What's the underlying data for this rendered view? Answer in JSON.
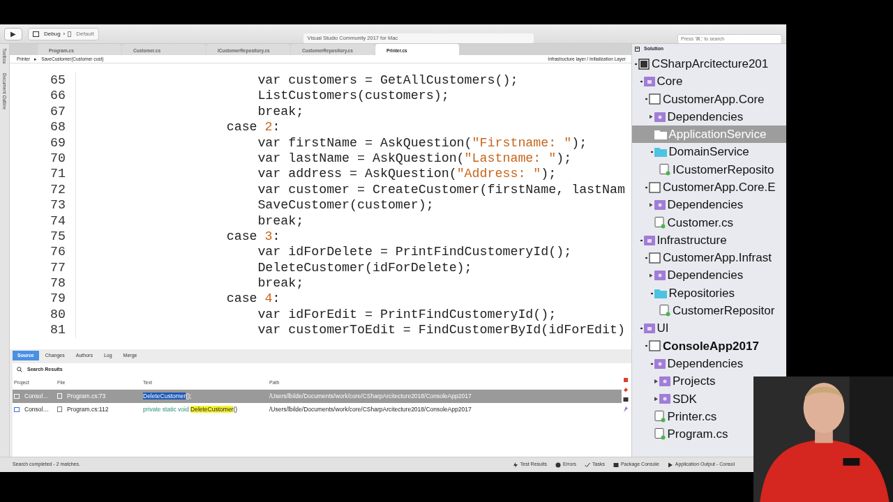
{
  "toolbar": {
    "run_label": "▶",
    "config": "Debug",
    "separator": "›",
    "target": "Default",
    "title": "Visual Studio Community 2017 for Mac",
    "search": {
      "placeholder": "Press '⌘,' to search"
    }
  },
  "side_strip": [
    "Toolbox",
    "Document Outline"
  ],
  "editor_tabs": [
    {
      "label": "Program.cs",
      "selected": false
    },
    {
      "label": "Customer.cs",
      "selected": false
    },
    {
      "label": "ICustomerRepository.cs",
      "selected": false
    },
    {
      "label": "CustomerRepository.cs",
      "selected": false
    },
    {
      "label": "Printer.cs",
      "selected": true
    }
  ],
  "breadcrumb": {
    "items": [
      "Printer",
      "SaveCustomer(Customer cust)"
    ],
    "separator": "▸",
    "right": "Infrastructure layer / Initialization Layer"
  },
  "code_lines": [
    {
      "number": "65",
      "kind": "statement",
      "segments": [
        {
          "text": "var customers = GetAllCustomers();",
          "kind": "plain"
        }
      ]
    },
    {
      "number": "66",
      "kind": "statement",
      "segments": [
        {
          "text": "ListCustomers(customers);",
          "kind": "plain"
        }
      ]
    },
    {
      "number": "67",
      "kind": "statement",
      "segments": [
        {
          "text": "break;",
          "kind": "plain"
        }
      ]
    },
    {
      "number": "68",
      "kind": "case",
      "segments": [
        {
          "text": "case ",
          "kind": "plain"
        },
        {
          "text": "2",
          "kind": "number"
        },
        {
          "text": ":",
          "kind": "plain"
        }
      ]
    },
    {
      "number": "69",
      "kind": "statement",
      "segments": [
        {
          "text": "var firstName = AskQuestion(",
          "kind": "plain"
        },
        {
          "text": "\"Firstname: \"",
          "kind": "string"
        },
        {
          "text": ");",
          "kind": "plain"
        }
      ]
    },
    {
      "number": "70",
      "kind": "statement",
      "segments": [
        {
          "text": "var lastName = AskQuestion(",
          "kind": "plain"
        },
        {
          "text": "\"Lastname: \"",
          "kind": "string"
        },
        {
          "text": ");",
          "kind": "plain"
        }
      ]
    },
    {
      "number": "71",
      "kind": "statement",
      "segments": [
        {
          "text": "var address = AskQuestion(",
          "kind": "plain"
        },
        {
          "text": "\"Address: \"",
          "kind": "string"
        },
        {
          "text": ");",
          "kind": "plain"
        }
      ]
    },
    {
      "number": "72",
      "kind": "statement",
      "segments": [
        {
          "text": "var customer = CreateCustomer(firstName, lastNam",
          "kind": "plain"
        }
      ]
    },
    {
      "number": "73",
      "kind": "statement",
      "segments": [
        {
          "text": "SaveCustomer(customer);",
          "kind": "plain"
        }
      ]
    },
    {
      "number": "74",
      "kind": "statement",
      "segments": [
        {
          "text": "break;",
          "kind": "plain"
        }
      ]
    },
    {
      "number": "75",
      "kind": "case",
      "segments": [
        {
          "text": "case ",
          "kind": "plain"
        },
        {
          "text": "3",
          "kind": "number"
        },
        {
          "text": ":",
          "kind": "plain"
        }
      ]
    },
    {
      "number": "76",
      "kind": "statement",
      "segments": [
        {
          "text": "var idForDelete = PrintFindCustomeryId();",
          "kind": "plain"
        }
      ]
    },
    {
      "number": "77",
      "kind": "statement",
      "segments": [
        {
          "text": "DeleteCustomer(idForDelete);",
          "kind": "plain"
        }
      ]
    },
    {
      "number": "78",
      "kind": "statement",
      "segments": [
        {
          "text": "break;",
          "kind": "plain"
        }
      ]
    },
    {
      "number": "79",
      "kind": "case",
      "segments": [
        {
          "text": "case ",
          "kind": "plain"
        },
        {
          "text": "4",
          "kind": "number"
        },
        {
          "text": ":",
          "kind": "plain"
        }
      ]
    },
    {
      "number": "80",
      "kind": "statement",
      "segments": [
        {
          "text": "var idForEdit = PrintFindCustomeryId();",
          "kind": "plain"
        }
      ]
    },
    {
      "number": "81",
      "kind": "statement",
      "segments": [
        {
          "text": "var customerToEdit = FindCustomerById(idForEdit)",
          "kind": "plain"
        }
      ]
    }
  ],
  "pad_tabs": [
    {
      "label": "Source",
      "selected": true
    },
    {
      "label": "Changes",
      "selected": false
    },
    {
      "label": "Authors",
      "selected": false
    },
    {
      "label": "Log",
      "selected": false
    },
    {
      "label": "Merge",
      "selected": false
    }
  ],
  "search_results": {
    "title": "Search Results",
    "columns": [
      "Project",
      "File",
      "Text",
      "Path"
    ],
    "rows": [
      {
        "project": "Consol…",
        "file": "Program.cs:73",
        "selected": true,
        "text": [
          {
            "text": "DeleteCustomer",
            "kind": "match"
          },
          {
            "text": "();",
            "kind": "plain"
          }
        ],
        "path": "/Users/lbilde/Documents/work/core/CSharpArcitecture2018/ConsoleApp2017"
      },
      {
        "project": "Consol…",
        "file": "Program.cs:112",
        "selected": false,
        "text": [
          {
            "text": "private static void ",
            "kind": "keyword"
          },
          {
            "text": "DeleteCustomer",
            "kind": "match"
          },
          {
            "text": "()",
            "kind": "plain"
          }
        ],
        "path": "/Users/lbilde/Documents/work/core/CSharpArcitecture2018/ConsoleApp2017"
      }
    ]
  },
  "solution": {
    "title": "Solution",
    "tree": [
      {
        "label": "CSharpArcitecture201",
        "kind": "solution",
        "expanded": true,
        "selected": false,
        "children": [
          {
            "label": "Core",
            "kind": "solution-folder",
            "expanded": true,
            "selected": false,
            "children": [
              {
                "label": "CustomerApp.Core",
                "kind": "project",
                "expanded": true,
                "selected": false,
                "children": [
                  {
                    "label": "Dependencies",
                    "kind": "dependencies",
                    "expanded": false,
                    "selected": false
                  },
                  {
                    "label": "ApplicationService",
                    "kind": "folder",
                    "selected": true
                  },
                  {
                    "label": "DomainService",
                    "kind": "folder",
                    "expanded": true,
                    "selected": false,
                    "children": [
                      {
                        "label": "ICustomerReposito",
                        "kind": "file",
                        "selected": false
                      }
                    ]
                  }
                ]
              },
              {
                "label": "CustomerApp.Core.E",
                "kind": "project",
                "expanded": true,
                "selected": false,
                "children": [
                  {
                    "label": "Dependencies",
                    "kind": "dependencies",
                    "expanded": false,
                    "selected": false
                  },
                  {
                    "label": "Customer.cs",
                    "kind": "file",
                    "selected": false
                  }
                ]
              }
            ]
          },
          {
            "label": "Infrastructure",
            "kind": "solution-folder",
            "expanded": true,
            "selected": false,
            "children": [
              {
                "label": "CustomerApp.Infrast",
                "kind": "project",
                "expanded": true,
                "selected": false,
                "children": [
                  {
                    "label": "Dependencies",
                    "kind": "dependencies",
                    "expanded": false,
                    "selected": false
                  },
                  {
                    "label": "Repositories",
                    "kind": "folder",
                    "expanded": true,
                    "selected": false,
                    "children": [
                      {
                        "label": "CustomerRepositor",
                        "kind": "file",
                        "selected": false
                      }
                    ]
                  }
                ]
              }
            ]
          },
          {
            "label": "UI",
            "kind": "solution-folder",
            "expanded": true,
            "selected": false,
            "children": [
              {
                "label": "ConsoleApp2017",
                "kind": "project",
                "startup": true,
                "expanded": true,
                "selected": false,
                "children": [
                  {
                    "label": "Dependencies",
                    "kind": "dependencies",
                    "expanded": true,
                    "selected": false,
                    "children": [
                      {
                        "label": "Projects",
                        "kind": "dependencies",
                        "expanded": false,
                        "selected": false
                      },
                      {
                        "label": "SDK",
                        "kind": "dependencies",
                        "expanded": false,
                        "selected": false
                      }
                    ]
                  },
                  {
                    "label": "Printer.cs",
                    "kind": "file",
                    "selected": false
                  },
                  {
                    "label": "Program.cs",
                    "kind": "file",
                    "selected": false
                  }
                ]
              }
            ]
          }
        ]
      }
    ]
  },
  "status": {
    "message": "Search completed - 2 matches.",
    "pads": [
      {
        "label": "Test Results",
        "kind": "tests"
      },
      {
        "label": "Errors",
        "kind": "errors"
      },
      {
        "label": "Tasks",
        "kind": "tasks"
      },
      {
        "label": "Package Console",
        "kind": "console"
      },
      {
        "label": "Application Output - Consol",
        "kind": "output"
      }
    ]
  },
  "presenter": {
    "kind": "picture"
  }
}
